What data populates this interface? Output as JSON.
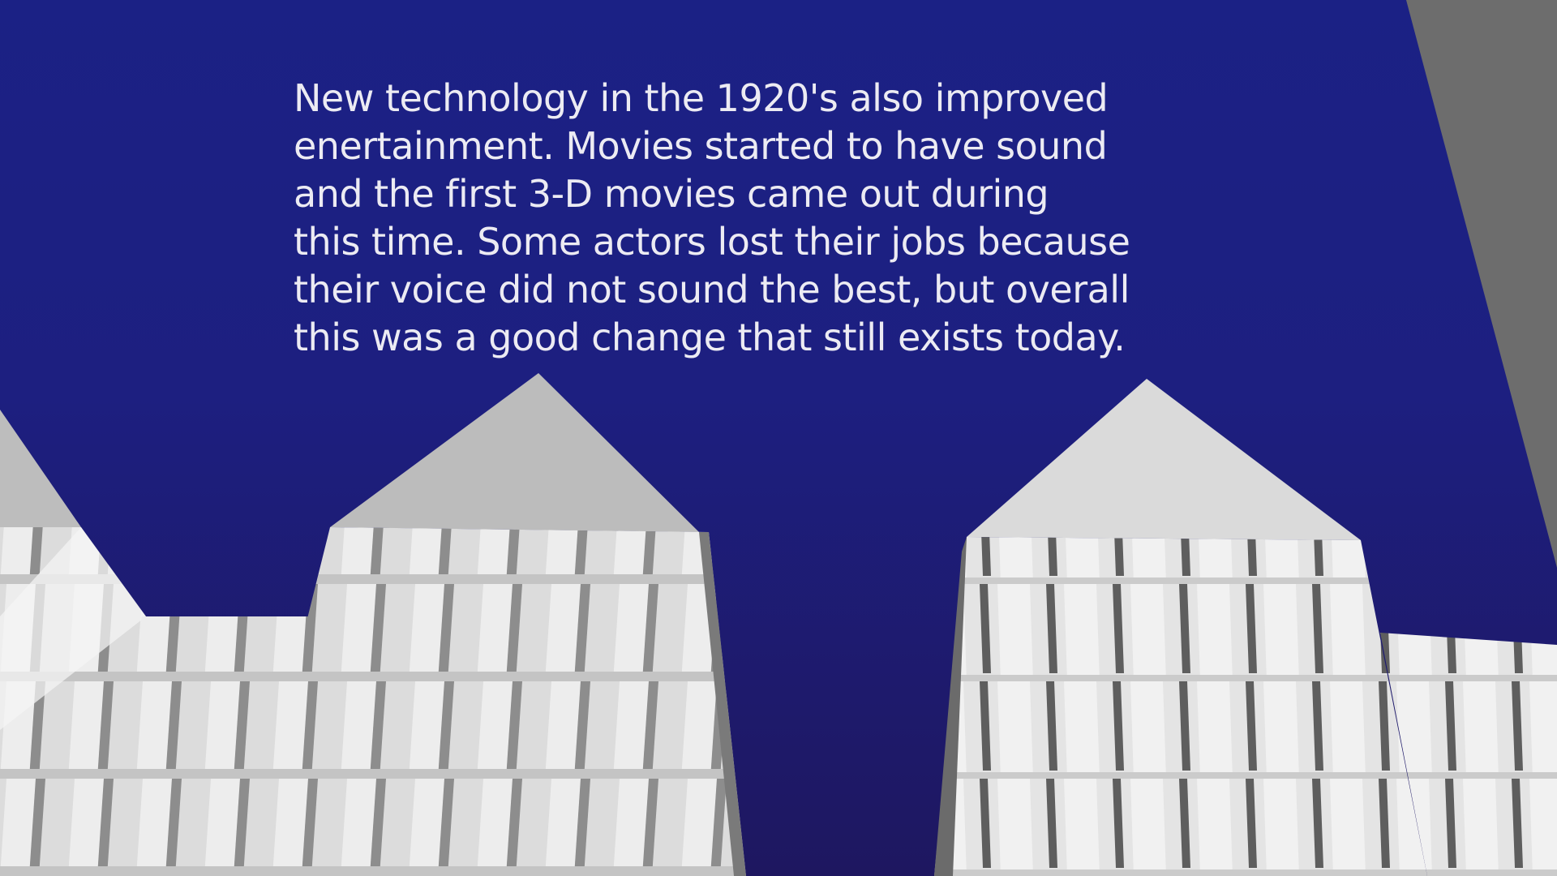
{
  "slide": {
    "body_text": "New technology in the 1920's also improved\nenertainment.  Movies started to have sound\nand the first 3-D movies came out during\nthis time.  Some actors lost their jobs because\ntheir voice did not sound the best, but overall\nthis was a good change that still exists today."
  },
  "colors": {
    "sky_top": "#1b2185",
    "sky_bottom": "#1e1760",
    "text": "#ecebf3",
    "building_light": "#f2f2f2",
    "building_mid": "#cfcfcf",
    "building_shadow": "#8a8a8a",
    "building_dark": "#6b6b6b"
  }
}
